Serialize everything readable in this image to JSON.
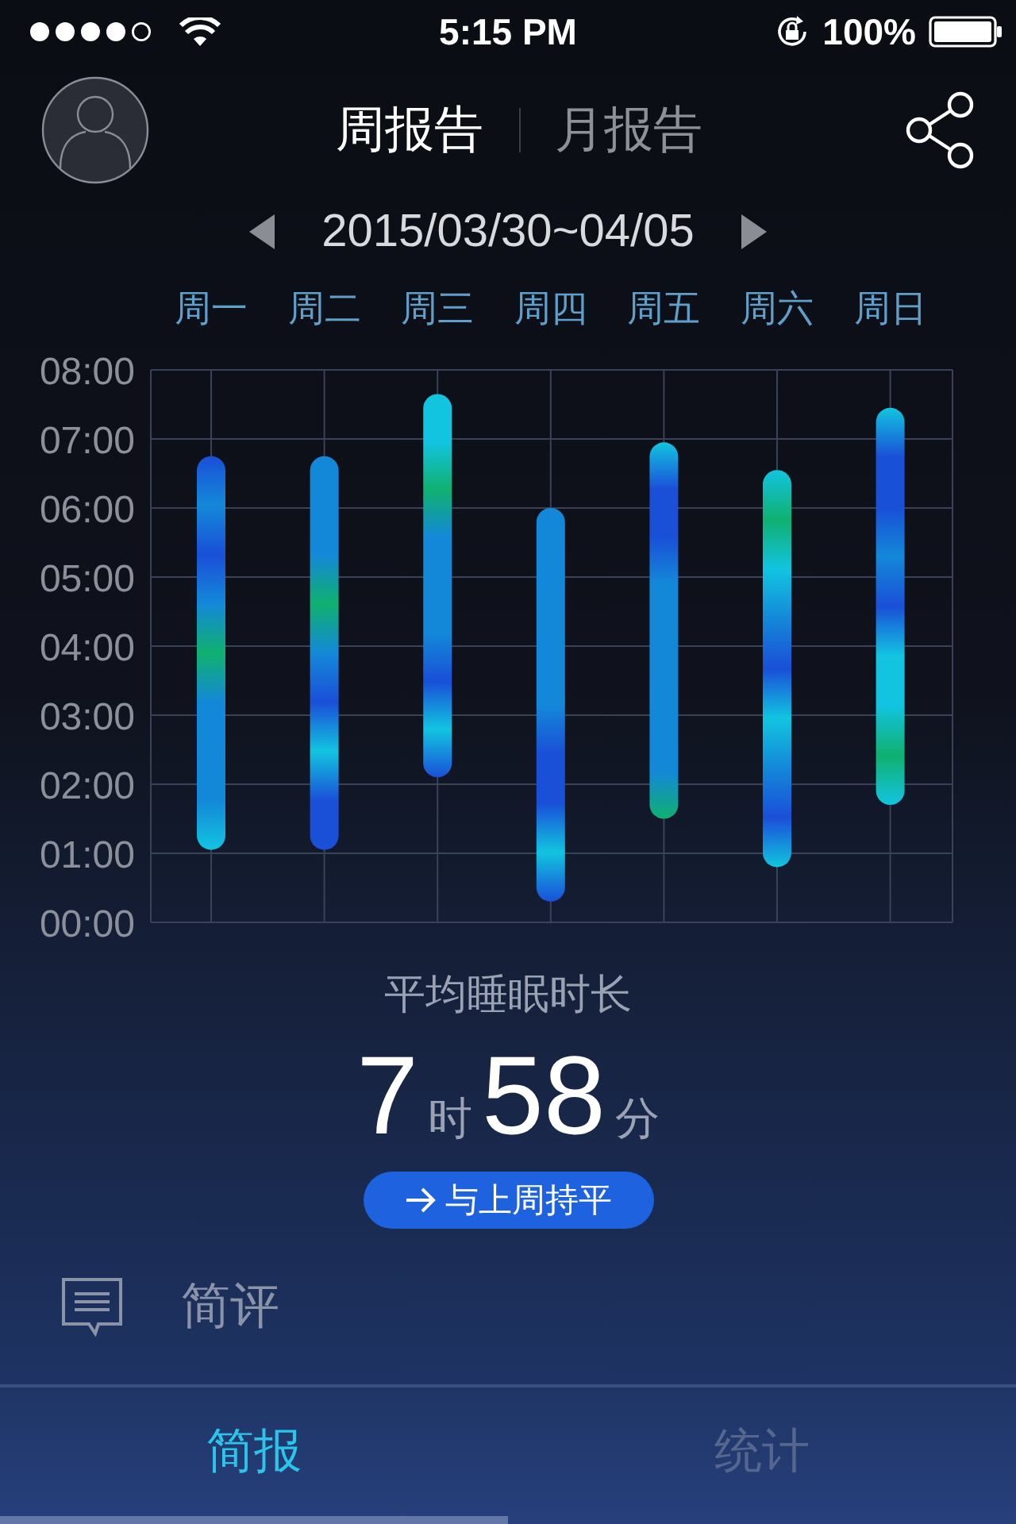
{
  "status_bar": {
    "time": "5:15 PM",
    "battery": "100%"
  },
  "header": {
    "tabs": [
      {
        "label": "周报告",
        "selected": true
      },
      {
        "label": "月报告",
        "selected": false
      }
    ]
  },
  "date_range": "2015/03/30~04/05",
  "sleep_chart": {
    "days": [
      "周一",
      "周二",
      "周三",
      "周四",
      "周五",
      "周六",
      "周日"
    ],
    "hour_labels": [
      "08:00",
      "07:00",
      "06:00",
      "05:00",
      "04:00",
      "03:00",
      "02:00",
      "01:00",
      "00:00"
    ]
  },
  "average": {
    "label": "平均睡眠时长",
    "hours": "7",
    "hours_unit": "时",
    "minutes": "58",
    "minutes_unit": "分"
  },
  "trend_button": "与上周持平",
  "comment": {
    "title": "简评"
  },
  "bottom_tabs": [
    {
      "label": "简报",
      "selected": true
    },
    {
      "label": "统计",
      "selected": false
    }
  ]
}
